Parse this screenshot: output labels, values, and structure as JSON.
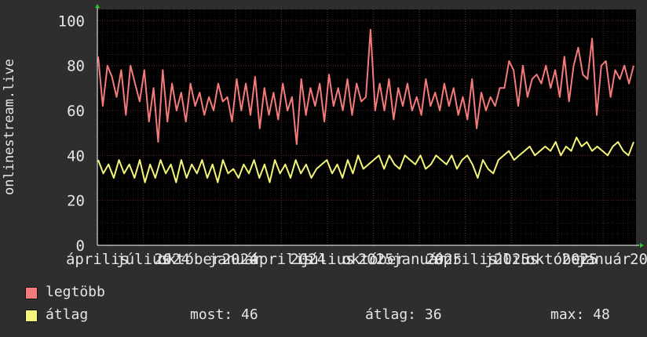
{
  "chart_data": {
    "type": "line",
    "ylabel": "onlinestream.live",
    "ylim": [
      0,
      105
    ],
    "yticks": [
      0,
      20,
      40,
      60,
      80,
      100
    ],
    "x_tick_labels": [
      "április",
      "július",
      "október",
      "január",
      "április",
      "július",
      "október",
      "január",
      "április",
      "július",
      "október",
      "január"
    ],
    "x_year_labels": [
      "2024",
      "2024",
      "2024",
      "2025",
      "2025",
      "2025",
      "2025",
      "2026"
    ],
    "grid": true,
    "legend_placement": "bottom-left",
    "series": [
      {
        "name": "legtöbb",
        "color": "#f57a7a",
        "values": [
          84,
          62,
          80,
          75,
          66,
          78,
          58,
          80,
          72,
          64,
          78,
          55,
          70,
          46,
          78,
          55,
          72,
          60,
          68,
          55,
          72,
          62,
          68,
          58,
          66,
          60,
          72,
          64,
          66,
          55,
          74,
          60,
          72,
          58,
          75,
          52,
          70,
          58,
          68,
          56,
          72,
          60,
          66,
          45,
          74,
          58,
          70,
          62,
          72,
          55,
          76,
          62,
          70,
          60,
          74,
          58,
          72,
          64,
          66,
          96,
          60,
          72,
          60,
          74,
          56,
          70,
          62,
          72,
          60,
          66,
          58,
          74,
          62,
          68,
          60,
          72,
          62,
          70,
          58,
          66,
          56,
          74,
          52,
          68,
          60,
          66,
          62,
          70,
          70,
          82,
          78,
          62,
          80,
          66,
          74,
          76,
          72,
          80,
          70,
          78,
          66,
          84,
          64,
          80,
          88,
          76,
          74,
          92,
          58,
          80,
          82,
          66,
          78,
          74,
          80,
          72,
          80
        ]
      },
      {
        "name": "átlag",
        "color": "#f5f57a",
        "values": [
          38,
          32,
          36,
          30,
          38,
          32,
          36,
          30,
          38,
          28,
          36,
          30,
          38,
          32,
          36,
          28,
          38,
          30,
          36,
          32,
          38,
          30,
          36,
          28,
          38,
          32,
          34,
          30,
          36,
          32,
          38,
          30,
          36,
          28,
          38,
          32,
          36,
          30,
          38,
          32,
          36,
          30,
          34,
          36,
          38,
          32,
          36,
          30,
          38,
          32,
          40,
          34,
          36,
          38,
          40,
          34,
          40,
          36,
          34,
          40,
          38,
          36,
          40,
          34,
          36,
          40,
          38,
          36,
          40,
          34,
          38,
          40,
          36,
          30,
          38,
          34,
          32,
          38,
          40,
          42,
          38,
          40,
          42,
          44,
          40,
          42,
          44,
          42,
          46,
          40,
          44,
          42,
          48,
          44,
          46,
          42,
          44,
          42,
          40,
          44,
          46,
          42,
          40,
          46
        ]
      }
    ]
  },
  "legend": {
    "items": [
      {
        "label": "legtöbb",
        "color": "#f57a7a"
      },
      {
        "label": "átlag",
        "color": "#f5f57a"
      }
    ],
    "stats": {
      "most": "most: 46",
      "atlag": "átlag: 36",
      "max": "max: 48"
    }
  }
}
